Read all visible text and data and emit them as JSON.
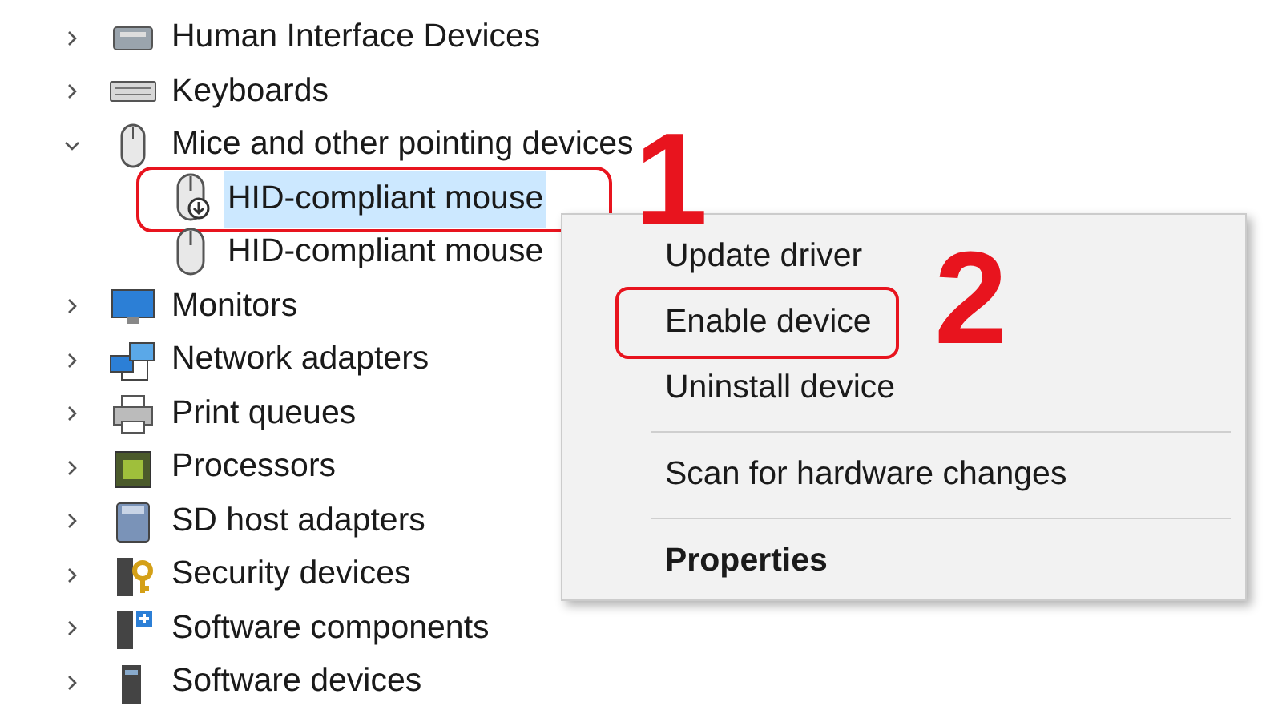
{
  "device_tree": [
    {
      "label": "Human Interface Devices",
      "expanded": false
    },
    {
      "label": "Keyboards",
      "expanded": false
    },
    {
      "label": "Mice and other pointing devices",
      "expanded": true,
      "children": [
        {
          "label": "HID-compliant mouse",
          "selected": true,
          "disabled": true,
          "annotated": true
        },
        {
          "label": "HID-compliant mouse",
          "selected": false,
          "disabled": false,
          "annotated": false
        }
      ]
    },
    {
      "label": "Monitors",
      "expanded": false
    },
    {
      "label": "Network adapters",
      "expanded": false
    },
    {
      "label": "Print queues",
      "expanded": false
    },
    {
      "label": "Processors",
      "expanded": false
    },
    {
      "label": "SD host adapters",
      "expanded": false
    },
    {
      "label": "Security devices",
      "expanded": false
    },
    {
      "label": "Software components",
      "expanded": false
    },
    {
      "label": "Software devices",
      "expanded": false
    }
  ],
  "context_menu": [
    {
      "kind": "item",
      "label": "Update driver",
      "bold": false,
      "annotated": false
    },
    {
      "kind": "item",
      "label": "Enable device",
      "bold": false,
      "annotated": true
    },
    {
      "kind": "item",
      "label": "Uninstall device",
      "bold": false,
      "annotated": false
    },
    {
      "kind": "separator"
    },
    {
      "kind": "item",
      "label": "Scan for hardware changes",
      "bold": false,
      "annotated": false
    },
    {
      "kind": "separator"
    },
    {
      "kind": "item",
      "label": "Properties",
      "bold": true,
      "annotated": false
    }
  ],
  "callouts": [
    {
      "number": "1"
    },
    {
      "number": "2"
    }
  ]
}
